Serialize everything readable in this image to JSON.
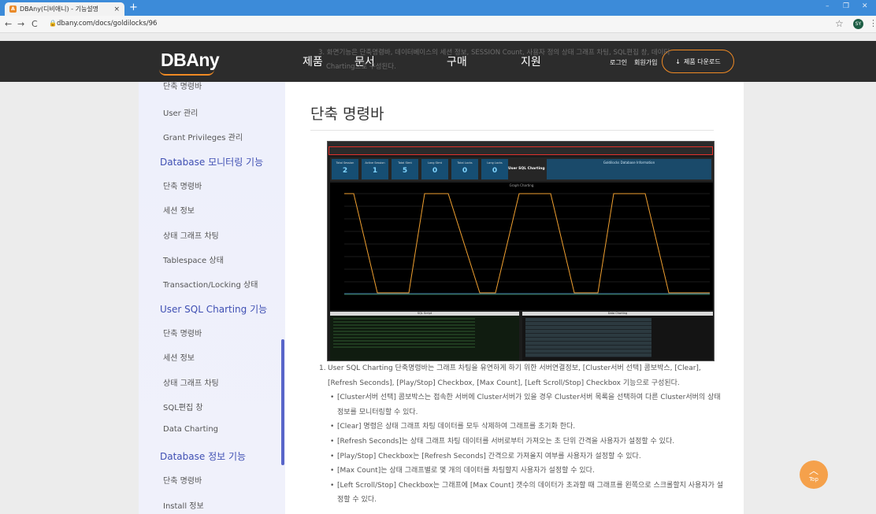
{
  "browser": {
    "tab_title": "DBAny(디비애니) - 기능설명",
    "tab_close": "×",
    "new_tab": "+",
    "url": "dbany.com/docs/goldilocks/96",
    "profile_initials": "SY",
    "controls": {
      "minimize": "–",
      "maximize": "❐",
      "close": "✕"
    },
    "nav": {
      "back": "←",
      "forward": "→",
      "reload": "C"
    }
  },
  "header": {
    "logo": "DBAny",
    "nav": [
      "제품",
      "문서",
      "구매",
      "지원"
    ],
    "login": "로그인",
    "signup": "회원가입",
    "download_button": "제품 다운로드",
    "overlay_line1": "3. 화면기능은 단축명령바, 데이터베이스의 세션 정보, SESSION Count, 사용자 정의 상태 그래프 차팅, SQL편집 창, 데이터",
    "overlay_line2": "Charting으로 구성된다."
  },
  "sidebar": {
    "items": [
      {
        "type": "item",
        "label": "단축 명령바"
      },
      {
        "type": "item",
        "label": "User 관리"
      },
      {
        "type": "item",
        "label": "Grant Privileges 관리"
      },
      {
        "type": "heading",
        "label": "Database 모니터링 기능"
      },
      {
        "type": "item",
        "label": "단축 명령바"
      },
      {
        "type": "item",
        "label": "세션 정보"
      },
      {
        "type": "item",
        "label": "상태 그래프 차팅"
      },
      {
        "type": "item",
        "label": "Tablespace 상태"
      },
      {
        "type": "item",
        "label": "Transaction/Locking 상태"
      },
      {
        "type": "heading",
        "label": "User SQL Charting 기능"
      },
      {
        "type": "item",
        "label": "단축 명령바"
      },
      {
        "type": "item",
        "label": "세션 정보"
      },
      {
        "type": "item",
        "label": "상태 그래프 차팅"
      },
      {
        "type": "item",
        "label": "SQL편집 창"
      },
      {
        "type": "item",
        "label": "Data Charting"
      },
      {
        "type": "heading",
        "label": "Database 정보 기능"
      },
      {
        "type": "item",
        "label": "단축 명령바"
      },
      {
        "type": "item",
        "label": "Install 정보"
      }
    ]
  },
  "main": {
    "title": "단축 명령바",
    "screenshot": {
      "stats": [
        {
          "label": "Total Session",
          "value": "2"
        },
        {
          "label": "Active Session",
          "value": "1"
        },
        {
          "label": "Total Stmt",
          "value": "5"
        },
        {
          "label": "Long Stmt",
          "value": "0"
        },
        {
          "label": "Total Locks",
          "value": "0"
        },
        {
          "label": "Long Locks",
          "value": "0"
        }
      ],
      "sql_charting_label": "User SQL Charting",
      "info_title": "Goldilocks Database Information",
      "chart_title": "Graph Charting",
      "sql_panel_title": "SQL Script",
      "data_panel_title": "Data Charting"
    },
    "desc_number": "1.",
    "desc_intro": "User SQL Charting 단축명령바는 그래프 차팅을 유연하게 하기 위한 서버연결정보, [Cluster서버 선택] 콤보박스, [Clear], [Refresh Seconds], [Play/Stop] Checkbox, [Max Count], [Left Scroll/Stop] Checkbox 기능으로 구성된다.",
    "bullets": [
      "[Cluster서버 선택] 콤보박스는 접속한 서버에 Cluster서버가 있을 경우 Cluster서버 목록을 선택하여 다른 Cluster서버의 상태 정보를 모니터링할 수 있다.",
      "[Clear] 명령은 상태 그래프 차팅 데이터를 모두 삭제하여 그래프를 초기화 한다.",
      "[Refresh Seconds]는 상태 그래프 차팅 데이터를 서버로부터 가져오는 초 단위 간격을 사용자가 설정할 수 있다.",
      "[Play/Stop] Checkbox는 [Refresh Seconds] 간격으로 가져올지 여부를 사용자가 설정할 수 있다.",
      "[Max Count]는 상태 그래프별로 몇 개의 데이터를 차팅할지 사용자가 설정할 수 있다.",
      "[Left Scroll/Stop] Checkbox는 그래프에 [Max Count] 갯수의 데이터가 초과할 때 그래프를 왼쪽으로 스크롤할지 사용자가 설정할 수 있다."
    ]
  },
  "top_button": {
    "label": "Top"
  }
}
